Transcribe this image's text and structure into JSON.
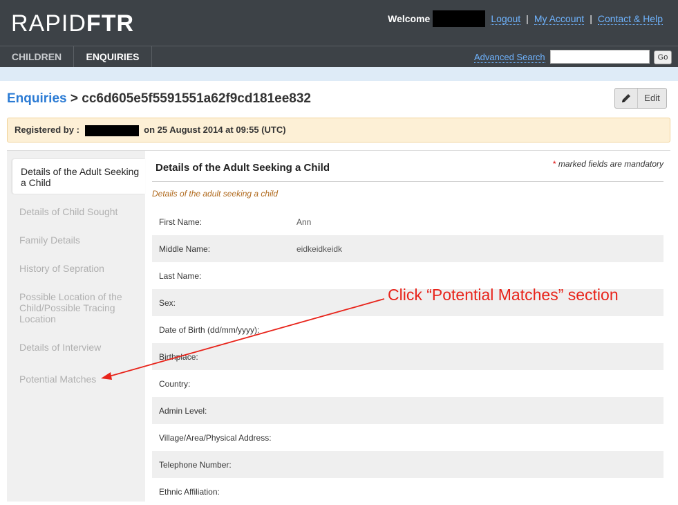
{
  "header": {
    "logo_light": "RAPID",
    "logo_bold": "FTR",
    "welcome": "Welcome",
    "links": [
      "Logout",
      "My Account",
      "Contact & Help"
    ],
    "separator": "|"
  },
  "nav": {
    "tabs": [
      "CHILDREN",
      "ENQUIRIES"
    ],
    "active_tab": "ENQUIRIES",
    "advanced_search": "Advanced Search",
    "search_value": "",
    "go_label": "Go"
  },
  "breadcrumb": {
    "link": "Enquiries",
    "separator": ">",
    "record_id": "cc6d605e5f5591551a62f9cd181ee832"
  },
  "edit_button": {
    "label": "Edit",
    "icon": "pencil-icon"
  },
  "registered": {
    "prefix": "Registered by :",
    "suffix": "on 25 August 2014 at 09:55 (UTC)"
  },
  "sidebar": {
    "items": [
      "Details of the Adult Seeking a Child",
      "Details of Child Sought",
      "Family Details",
      "History of Sepration",
      "Possible Location of the Child/Possible Tracing Location",
      "Details of Interview",
      "Potential Matches"
    ],
    "active_index": 0
  },
  "form": {
    "title": "Details of the Adult Seeking a Child",
    "mandatory_star": "*",
    "mandatory_note": "marked fields are mandatory",
    "subheading": "Details of the adult seeking a child",
    "fields": [
      {
        "label": "First Name:",
        "value": "Ann"
      },
      {
        "label": "Middle Name:",
        "value": "eidkeidkeidk"
      },
      {
        "label": "Last Name:",
        "value": ""
      },
      {
        "label": "Sex:",
        "value": ""
      },
      {
        "label": "Date of Birth (dd/mm/yyyy):",
        "value": ""
      },
      {
        "label": "Birthplace:",
        "value": ""
      },
      {
        "label": "Country:",
        "value": ""
      },
      {
        "label": "Admin Level:",
        "value": ""
      },
      {
        "label": "Village/Area/Physical Address:",
        "value": ""
      },
      {
        "label": "Telephone Number:",
        "value": ""
      },
      {
        "label": "Ethnic Affiliation:",
        "value": ""
      }
    ]
  },
  "annotation": {
    "text": "Click “Potential Matches” section",
    "color": "#e8231a"
  },
  "colors": {
    "header_bg": "#3d4247",
    "link_blue": "#2b7bd4",
    "registered_bg": "#fdf0d6",
    "subheading": "#b06a1e"
  }
}
